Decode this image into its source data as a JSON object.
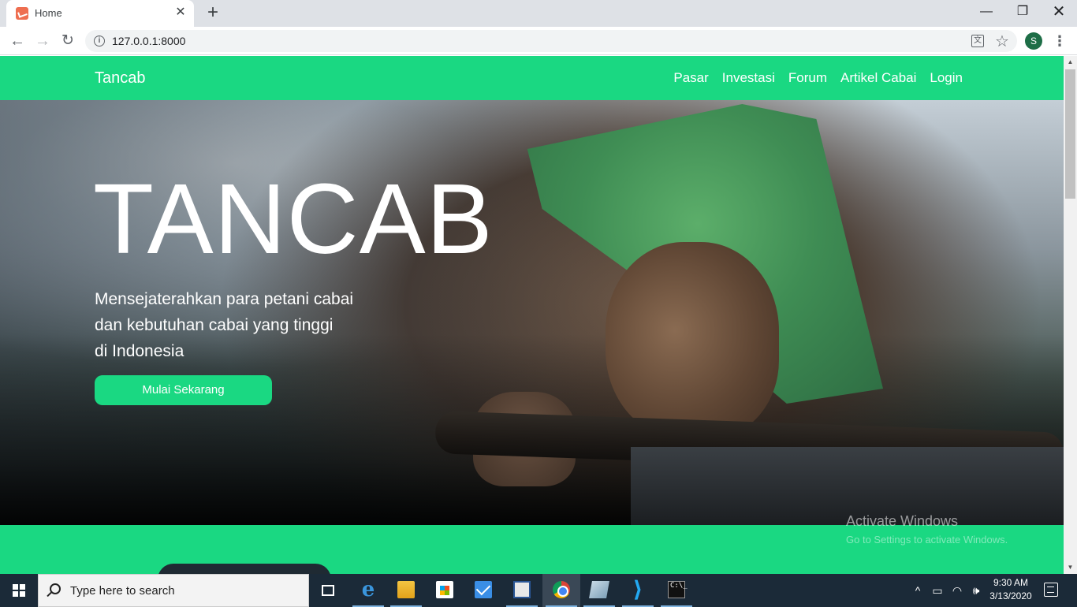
{
  "browser": {
    "tab_title": "Home",
    "url": "127.0.0.1:8000",
    "profile_initial": "S",
    "icons": [
      "back-arrow-icon",
      "forward-arrow-icon",
      "reload-icon",
      "info-icon",
      "translate-icon",
      "star-icon",
      "menu-icon"
    ]
  },
  "site": {
    "brand": "Tancab",
    "nav": [
      "Pasar",
      "Investasi",
      "Forum",
      "Artikel Cabai",
      "Login"
    ],
    "hero": {
      "title": "TANCAB",
      "subtitle_lines": [
        "Mensejaterahkan para petani cabai",
        "dan kebutuhan cabai yang tinggi",
        "di Indonesia"
      ],
      "cta": "Mulai Sekarang"
    },
    "colors": {
      "accent": "#1ad882",
      "band_pill": "#1f2a33"
    }
  },
  "windows": {
    "watermark_title": "Activate Windows",
    "watermark_sub": "Go to Settings to activate Windows.",
    "search_placeholder": "Type here to search",
    "time": "9:30 AM",
    "date": "3/13/2020",
    "taskbar_apps": [
      "task-view",
      "edge",
      "file-explorer",
      "store",
      "mail",
      "word",
      "chrome",
      "dist",
      "vscode",
      "terminal"
    ]
  }
}
